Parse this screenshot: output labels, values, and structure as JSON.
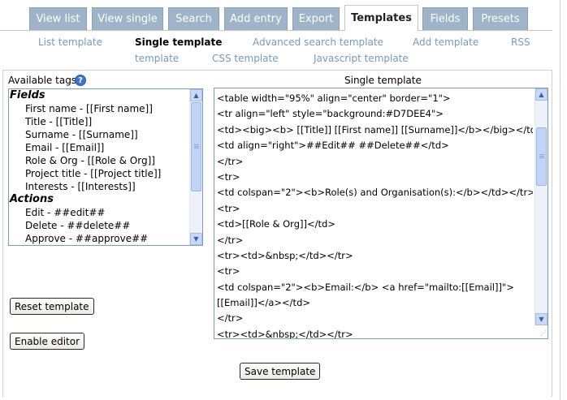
{
  "tabs": [
    {
      "label": "View list"
    },
    {
      "label": "View single"
    },
    {
      "label": "Search"
    },
    {
      "label": "Add entry"
    },
    {
      "label": "Export"
    },
    {
      "label": "Templates"
    },
    {
      "label": "Fields"
    },
    {
      "label": "Presets"
    }
  ],
  "subnav": {
    "list_template": "List template",
    "single_template": "Single template",
    "advanced_search_template": "Advanced search template",
    "add_template": "Add template",
    "rss_template_line1": "RSS",
    "rss_template_line2": "template",
    "css_template": "CSS template",
    "javascript_template": "Javascript template"
  },
  "available_tags": {
    "label": "Available tags",
    "help_icon_glyph": "?",
    "groups": [
      {
        "name": "Fields",
        "items": [
          "First name - [[First name]]",
          "Title - [[Title]]",
          "Surname - [[Surname]]",
          "Email - [[Email]]",
          "Role & Org - [[Role & Org]]",
          "Project title - [[Project title]]",
          "Interests - [[Interests]]"
        ]
      },
      {
        "name": "Actions",
        "items": [
          "Edit - ##edit##",
          "Delete - ##delete##",
          "Approve - ##approve##"
        ]
      }
    ]
  },
  "editor": {
    "title": "Single template",
    "lines": [
      "<table width=\"95%\" align=\"center\" border=\"1\">",
      "<tr align=\"left\" style=\"background:#D7DEE4\">",
      "<td><big><b> [[Title]] [[First name]] [[Surname]]</b></big></td>",
      "<td align=\"right\">##Edit## ##Delete##</td>",
      "</tr>",
      "<tr>",
      "<td colspan=\"2\"><b>Role(s) and Organisation(s):</b></td></tr>",
      "<tr>",
      "<td>[[Role & Org]]</td>",
      "</tr>",
      "<tr><td>&nbsp;</td></tr>",
      "<tr>",
      "<td colspan=\"2\"><b>Email:</b> <a href=\"mailto:[[Email]]\">",
      "[[Email]]</a></td>",
      "</tr>",
      "<tr><td>&nbsp;</td></tr>"
    ]
  },
  "buttons": {
    "reset_template": "Reset template",
    "enable_editor": "Enable editor",
    "save_template": "Save template"
  },
  "colors": {
    "tab_inactive": "#9fb4c8",
    "link": "#7b9ab5",
    "scrollbar": "#c8d8f5"
  }
}
